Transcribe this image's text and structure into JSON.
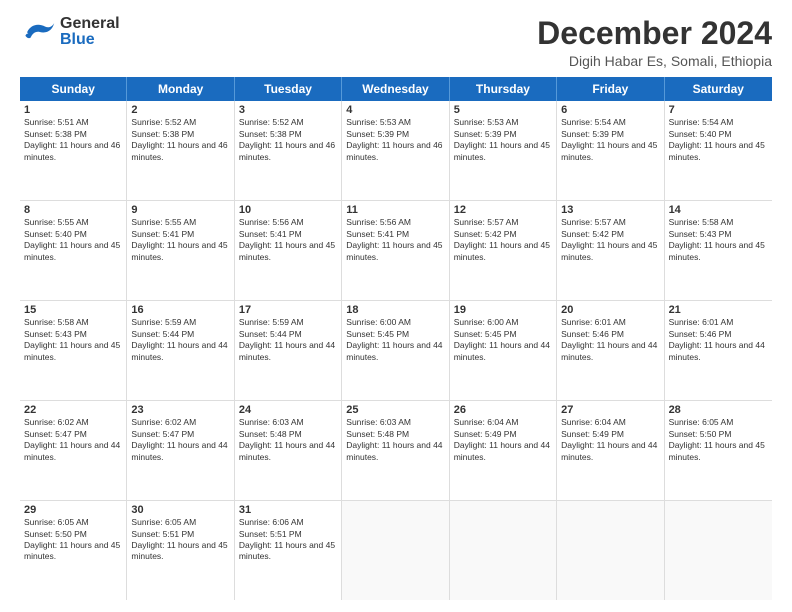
{
  "header": {
    "logo_general": "General",
    "logo_blue": "Blue",
    "month": "December 2024",
    "location": "Digih Habar Es, Somali, Ethiopia"
  },
  "days": [
    "Sunday",
    "Monday",
    "Tuesday",
    "Wednesday",
    "Thursday",
    "Friday",
    "Saturday"
  ],
  "weeks": [
    [
      {
        "day": "1",
        "sunrise": "Sunrise: 5:51 AM",
        "sunset": "Sunset: 5:38 PM",
        "daylight": "Daylight: 11 hours and 46 minutes."
      },
      {
        "day": "2",
        "sunrise": "Sunrise: 5:52 AM",
        "sunset": "Sunset: 5:38 PM",
        "daylight": "Daylight: 11 hours and 46 minutes."
      },
      {
        "day": "3",
        "sunrise": "Sunrise: 5:52 AM",
        "sunset": "Sunset: 5:38 PM",
        "daylight": "Daylight: 11 hours and 46 minutes."
      },
      {
        "day": "4",
        "sunrise": "Sunrise: 5:53 AM",
        "sunset": "Sunset: 5:39 PM",
        "daylight": "Daylight: 11 hours and 46 minutes."
      },
      {
        "day": "5",
        "sunrise": "Sunrise: 5:53 AM",
        "sunset": "Sunset: 5:39 PM",
        "daylight": "Daylight: 11 hours and 45 minutes."
      },
      {
        "day": "6",
        "sunrise": "Sunrise: 5:54 AM",
        "sunset": "Sunset: 5:39 PM",
        "daylight": "Daylight: 11 hours and 45 minutes."
      },
      {
        "day": "7",
        "sunrise": "Sunrise: 5:54 AM",
        "sunset": "Sunset: 5:40 PM",
        "daylight": "Daylight: 11 hours and 45 minutes."
      }
    ],
    [
      {
        "day": "8",
        "sunrise": "Sunrise: 5:55 AM",
        "sunset": "Sunset: 5:40 PM",
        "daylight": "Daylight: 11 hours and 45 minutes."
      },
      {
        "day": "9",
        "sunrise": "Sunrise: 5:55 AM",
        "sunset": "Sunset: 5:41 PM",
        "daylight": "Daylight: 11 hours and 45 minutes."
      },
      {
        "day": "10",
        "sunrise": "Sunrise: 5:56 AM",
        "sunset": "Sunset: 5:41 PM",
        "daylight": "Daylight: 11 hours and 45 minutes."
      },
      {
        "day": "11",
        "sunrise": "Sunrise: 5:56 AM",
        "sunset": "Sunset: 5:41 PM",
        "daylight": "Daylight: 11 hours and 45 minutes."
      },
      {
        "day": "12",
        "sunrise": "Sunrise: 5:57 AM",
        "sunset": "Sunset: 5:42 PM",
        "daylight": "Daylight: 11 hours and 45 minutes."
      },
      {
        "day": "13",
        "sunrise": "Sunrise: 5:57 AM",
        "sunset": "Sunset: 5:42 PM",
        "daylight": "Daylight: 11 hours and 45 minutes."
      },
      {
        "day": "14",
        "sunrise": "Sunrise: 5:58 AM",
        "sunset": "Sunset: 5:43 PM",
        "daylight": "Daylight: 11 hours and 45 minutes."
      }
    ],
    [
      {
        "day": "15",
        "sunrise": "Sunrise: 5:58 AM",
        "sunset": "Sunset: 5:43 PM",
        "daylight": "Daylight: 11 hours and 45 minutes."
      },
      {
        "day": "16",
        "sunrise": "Sunrise: 5:59 AM",
        "sunset": "Sunset: 5:44 PM",
        "daylight": "Daylight: 11 hours and 44 minutes."
      },
      {
        "day": "17",
        "sunrise": "Sunrise: 5:59 AM",
        "sunset": "Sunset: 5:44 PM",
        "daylight": "Daylight: 11 hours and 44 minutes."
      },
      {
        "day": "18",
        "sunrise": "Sunrise: 6:00 AM",
        "sunset": "Sunset: 5:45 PM",
        "daylight": "Daylight: 11 hours and 44 minutes."
      },
      {
        "day": "19",
        "sunrise": "Sunrise: 6:00 AM",
        "sunset": "Sunset: 5:45 PM",
        "daylight": "Daylight: 11 hours and 44 minutes."
      },
      {
        "day": "20",
        "sunrise": "Sunrise: 6:01 AM",
        "sunset": "Sunset: 5:46 PM",
        "daylight": "Daylight: 11 hours and 44 minutes."
      },
      {
        "day": "21",
        "sunrise": "Sunrise: 6:01 AM",
        "sunset": "Sunset: 5:46 PM",
        "daylight": "Daylight: 11 hours and 44 minutes."
      }
    ],
    [
      {
        "day": "22",
        "sunrise": "Sunrise: 6:02 AM",
        "sunset": "Sunset: 5:47 PM",
        "daylight": "Daylight: 11 hours and 44 minutes."
      },
      {
        "day": "23",
        "sunrise": "Sunrise: 6:02 AM",
        "sunset": "Sunset: 5:47 PM",
        "daylight": "Daylight: 11 hours and 44 minutes."
      },
      {
        "day": "24",
        "sunrise": "Sunrise: 6:03 AM",
        "sunset": "Sunset: 5:48 PM",
        "daylight": "Daylight: 11 hours and 44 minutes."
      },
      {
        "day": "25",
        "sunrise": "Sunrise: 6:03 AM",
        "sunset": "Sunset: 5:48 PM",
        "daylight": "Daylight: 11 hours and 44 minutes."
      },
      {
        "day": "26",
        "sunrise": "Sunrise: 6:04 AM",
        "sunset": "Sunset: 5:49 PM",
        "daylight": "Daylight: 11 hours and 44 minutes."
      },
      {
        "day": "27",
        "sunrise": "Sunrise: 6:04 AM",
        "sunset": "Sunset: 5:49 PM",
        "daylight": "Daylight: 11 hours and 44 minutes."
      },
      {
        "day": "28",
        "sunrise": "Sunrise: 6:05 AM",
        "sunset": "Sunset: 5:50 PM",
        "daylight": "Daylight: 11 hours and 45 minutes."
      }
    ],
    [
      {
        "day": "29",
        "sunrise": "Sunrise: 6:05 AM",
        "sunset": "Sunset: 5:50 PM",
        "daylight": "Daylight: 11 hours and 45 minutes."
      },
      {
        "day": "30",
        "sunrise": "Sunrise: 6:05 AM",
        "sunset": "Sunset: 5:51 PM",
        "daylight": "Daylight: 11 hours and 45 minutes."
      },
      {
        "day": "31",
        "sunrise": "Sunrise: 6:06 AM",
        "sunset": "Sunset: 5:51 PM",
        "daylight": "Daylight: 11 hours and 45 minutes."
      },
      {
        "day": "",
        "sunrise": "",
        "sunset": "",
        "daylight": ""
      },
      {
        "day": "",
        "sunrise": "",
        "sunset": "",
        "daylight": ""
      },
      {
        "day": "",
        "sunrise": "",
        "sunset": "",
        "daylight": ""
      },
      {
        "day": "",
        "sunrise": "",
        "sunset": "",
        "daylight": ""
      }
    ]
  ]
}
